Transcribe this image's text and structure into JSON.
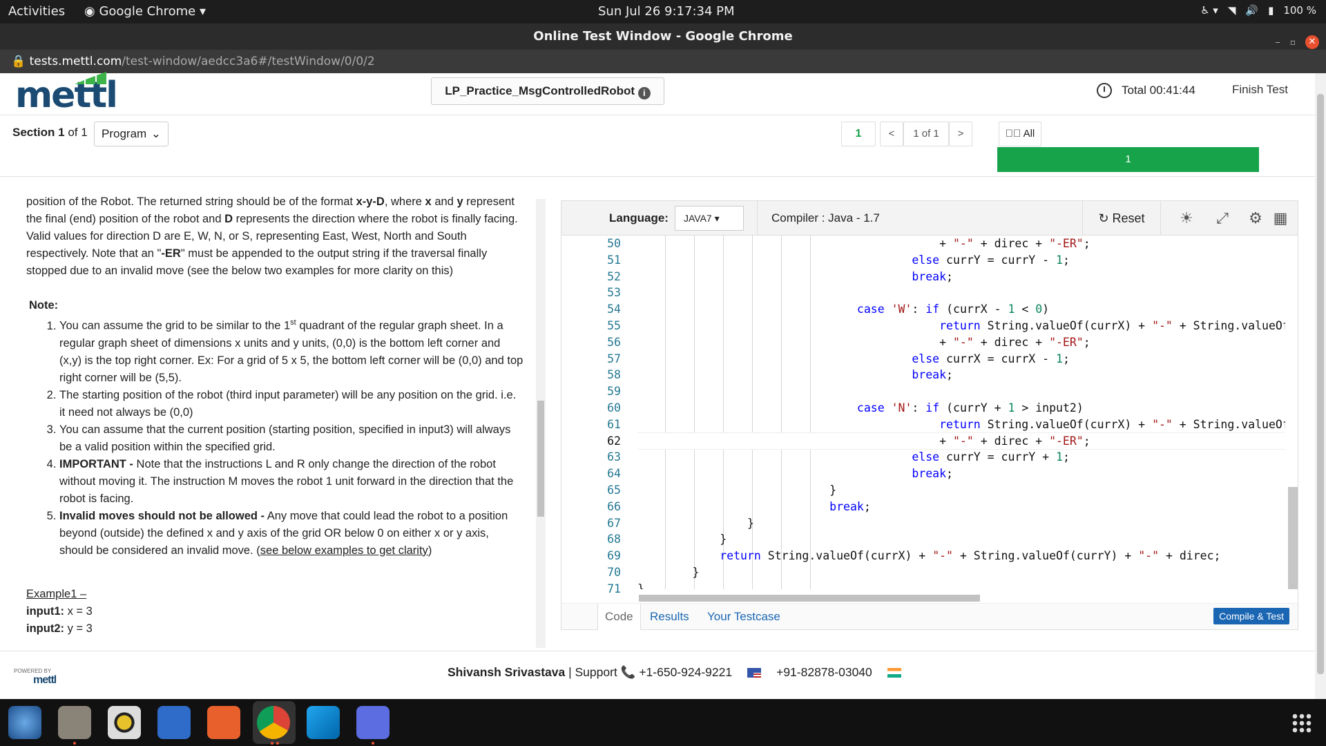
{
  "system_bar": {
    "activities": "Activities",
    "app_name": "Google Chrome ▾",
    "clock": "Sun Jul 26  9:17:34 PM",
    "battery": "100 %"
  },
  "window": {
    "title": "Online Test Window - Google Chrome"
  },
  "address_bar": {
    "host": "tests.mettl.com",
    "path": "/test-window/aedcc3a6#/testWindow/0/0/2"
  },
  "header": {
    "logo_text": "mettl",
    "test_title": "LP_Practice_MsgControlledRobot",
    "timer_label": "Total 00:41:44",
    "finish_label": "Finish Test"
  },
  "section_bar": {
    "section_text": "Section 1",
    "section_of": "of 1",
    "section_select": "Program",
    "question_number": "1",
    "prev": "<",
    "page_text": "1 of 1",
    "next": ">",
    "all_label": "All",
    "progress_label": "1"
  },
  "question": {
    "intro_1": "position of the Robot. The returned string should be of the format ",
    "intro_fmt": "x-y-D",
    "intro_2": ", where ",
    "intro_x": "x",
    "intro_3": " and ",
    "intro_y": "y",
    "intro_4": " represent the final (end) position of the robot and ",
    "intro_d": "D",
    "intro_5": " represents the direction where the robot is finally facing. Valid values for direction D are E, W, N, or S, representing East, West, North and South respectively. Note that an \"",
    "intro_er": "-ER",
    "intro_6": "\" must be appended to the output string if the traversal finally stopped due to an invalid move (see the below two examples for more clarity on this)",
    "note_heading": "Note:",
    "note_1a": "You can assume the grid to be similar to the 1",
    "note_1sup": "st",
    "note_1b": " quadrant of the regular graph sheet. In a regular graph sheet of dimensions x units and y units, (0,0) is the bottom left corner and (x,y) is the top right corner. Ex: For a grid of 5 x 5, the bottom left corner will be (0,0) and top right corner will be (5,5).",
    "note_2": "The starting position of the robot (third input parameter) will be any position on the grid. i.e. it need not always be (0,0)",
    "note_3": "You can assume that the current position (starting position, specified in input3) will always be a valid position within the specified grid.",
    "note_4_bold": "IMPORTANT -",
    "note_4": " Note that the instructions L and R only change the direction of the robot without moving it. The instruction M moves the robot 1 unit forward in the direction that the robot is facing.",
    "note_5_bold": "Invalid moves should not be allowed -",
    "note_5": " Any move that could lead the robot to a position beyond (outside) the defined x and y axis of the grid OR below 0 on either x or y axis, should be considered an invalid move. (",
    "note_5_link": "see below examples to get clarity",
    "note_5_end": ")",
    "example_heading": "Example1 –",
    "input1_label": "input1:",
    "input1_value": " x = 3",
    "input2_label": "input2:",
    "input2_value": " y = 3"
  },
  "editor": {
    "language_label": "Language:",
    "language_value": "JAVA7 ▾",
    "compiler_label": "Compiler : Java - 1.7",
    "reset_label": "Reset",
    "line_numbers": [
      "50",
      "51",
      "52",
      "53",
      "54",
      "55",
      "56",
      "57",
      "58",
      "59",
      "60",
      "61",
      "62",
      "63",
      "64",
      "65",
      "66",
      "67",
      "68",
      "69",
      "70",
      "71"
    ],
    "current_line": "62",
    "tab_code": "Code",
    "tab_results": "Results",
    "tab_testcase": "Your Testcase",
    "compile_label": "Compile & Test"
  },
  "footer": {
    "powered_by": "POWERED BY",
    "powered_brand": "mettl",
    "name": "Shivansh Srivastava",
    "support": " | Support ",
    "phone_us": "+1-650-924-9221",
    "phone_in": "+91-82878-03040"
  }
}
